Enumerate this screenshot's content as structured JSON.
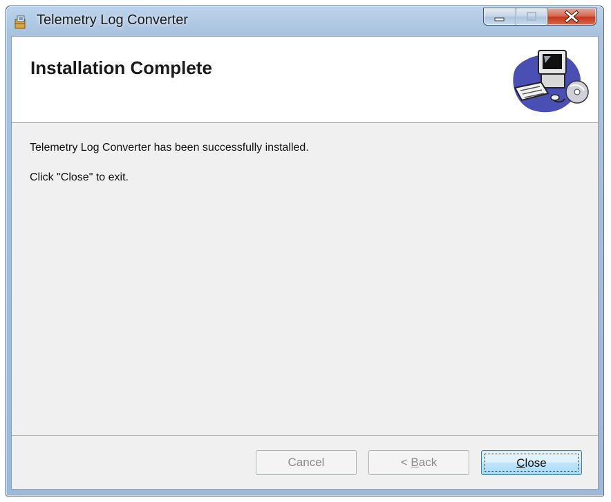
{
  "window": {
    "title": "Telemetry Log Converter",
    "icons": {
      "app": "installer-icon",
      "minimize": "minimize-icon",
      "maximize": "maximize-icon",
      "close": "close-icon"
    }
  },
  "banner": {
    "title": "Installation Complete",
    "art": "computer-setup-graphic"
  },
  "body": {
    "line1": "Telemetry Log Converter has been successfully installed.",
    "line2": "Click \"Close\" to exit."
  },
  "buttons": {
    "cancel": {
      "label": "Cancel",
      "enabled": false
    },
    "back": {
      "label_prefix": "< ",
      "mnemonic": "B",
      "label_rest": "ack",
      "enabled": false
    },
    "close": {
      "mnemonic": "C",
      "label_rest": "lose",
      "enabled": true,
      "default": true
    }
  },
  "colors": {
    "close_caption": "#c2371d",
    "default_button_border": "#3c7fb1",
    "disabled_text": "#8a8a8a"
  }
}
